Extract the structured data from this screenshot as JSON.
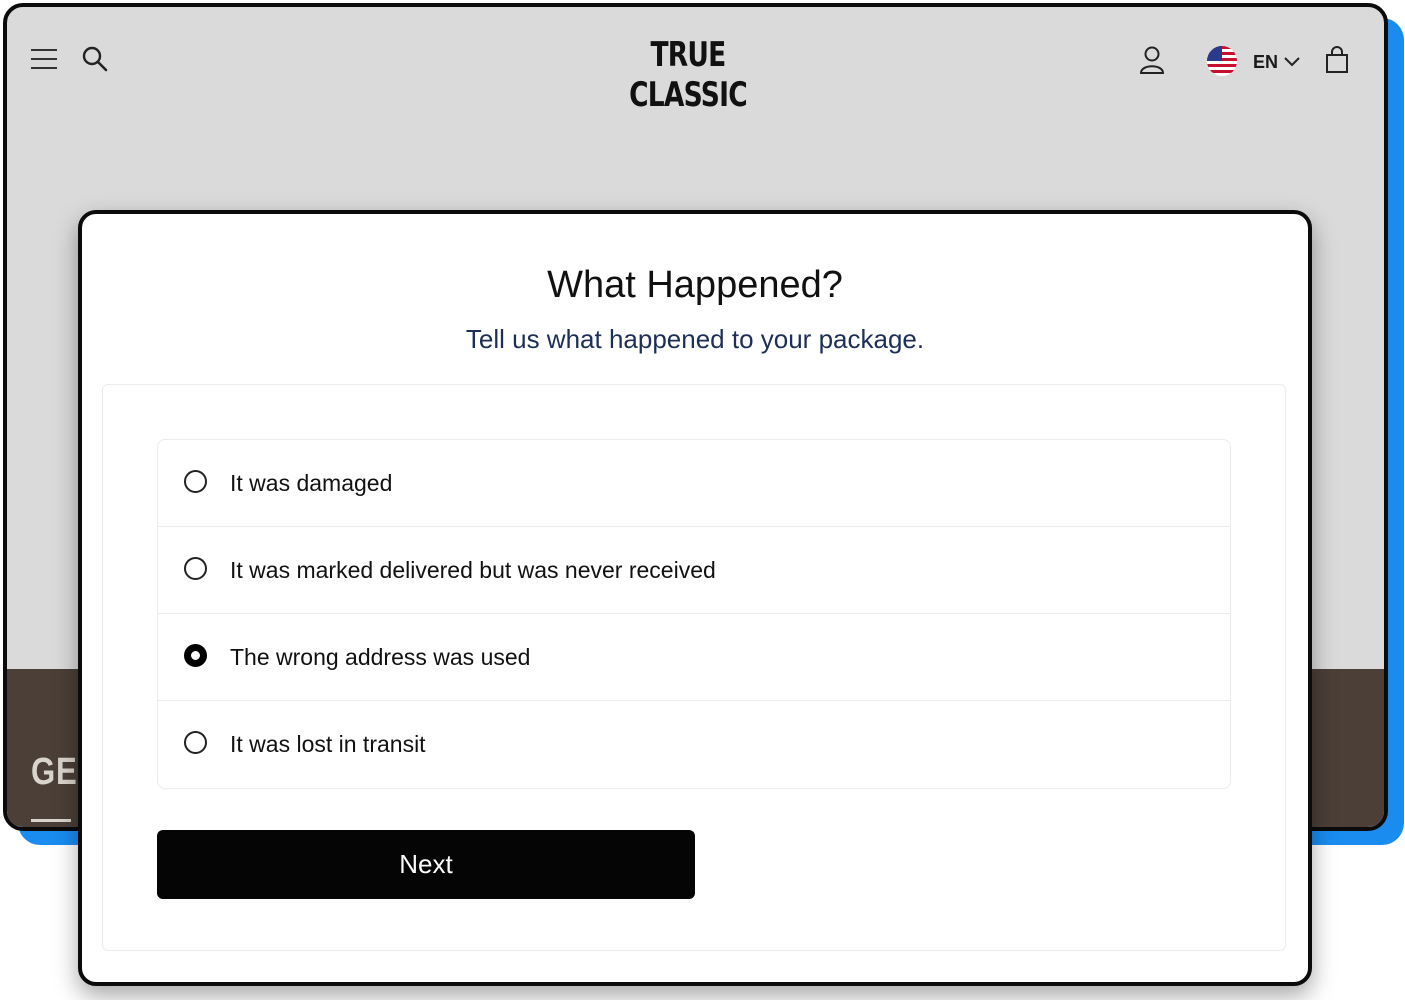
{
  "header": {
    "logo_text": "TRUE CLASSIC",
    "language": "EN"
  },
  "background_page": {
    "footer_cta": "GET"
  },
  "modal": {
    "title": "What Happened?",
    "subtitle": "Tell us what happened to your package.",
    "options": [
      {
        "label": "It was damaged",
        "selected": false
      },
      {
        "label": "It was marked delivered but was never received",
        "selected": false
      },
      {
        "label": "The wrong address was used",
        "selected": true
      },
      {
        "label": "It was lost in transit",
        "selected": false
      }
    ],
    "next_label": "Next"
  },
  "colors": {
    "accent_blue": "#1a8cf0",
    "footer_brown": "#4b3f37",
    "subtitle_navy": "#1d2f57"
  }
}
